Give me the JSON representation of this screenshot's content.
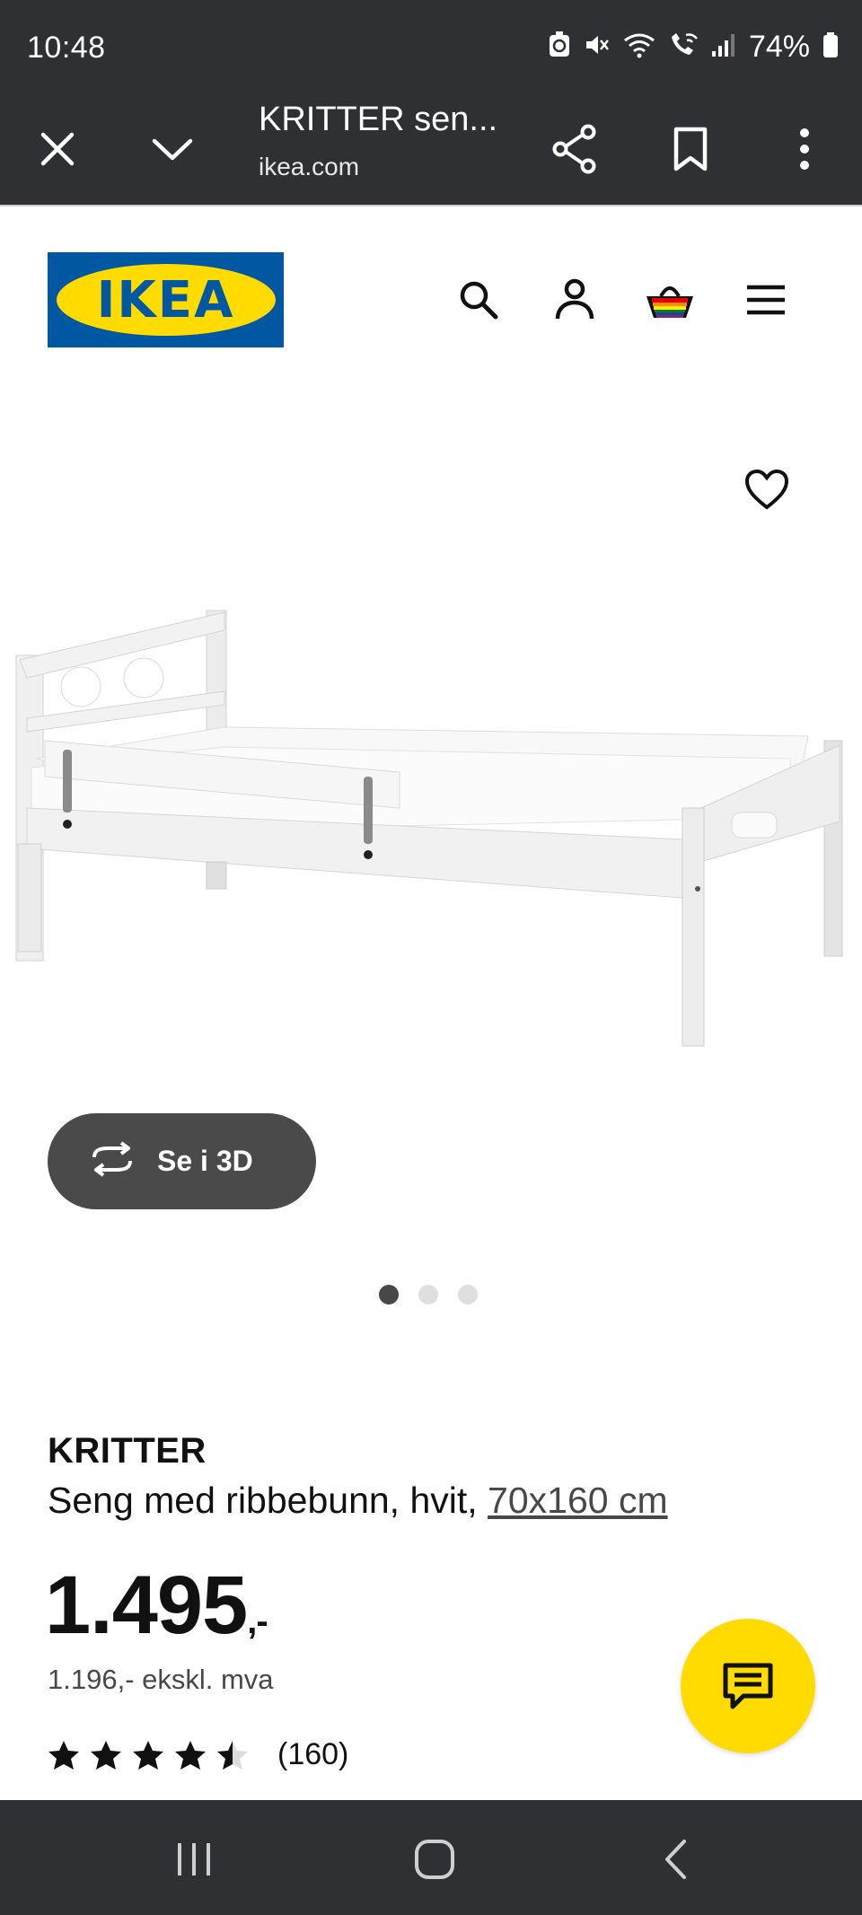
{
  "status_bar": {
    "time": "10:48",
    "battery": "74%",
    "icons": [
      "battery-saver-icon",
      "mute-icon",
      "wifi-icon",
      "wifi-calling-icon",
      "signal-icon",
      "battery-icon"
    ]
  },
  "browser": {
    "title": "KRITTER sen...",
    "url": "ikea.com",
    "icons": [
      "close-icon",
      "chevron-down-icon",
      "share-icon",
      "bookmark-icon",
      "more-icon"
    ]
  },
  "header": {
    "logo_text": "IKEA",
    "icons": [
      "search-icon",
      "account-icon",
      "basket-icon",
      "menu-icon"
    ]
  },
  "product": {
    "name": "KRITTER",
    "description": "Seng med ribbebunn, hvit, ",
    "size_link": "70x160 cm",
    "price_main": "1.495",
    "price_suffix": ",-",
    "price_ex_vat": "1.196,- ekskl. mva",
    "rating": 4.5,
    "rating_max": 5,
    "review_count": "(160)",
    "view3d_label": "Se i 3D",
    "image_count": 3,
    "active_image": 1
  },
  "colors": {
    "ikea_blue": "#0058a3",
    "ikea_yellow": "#ffdb00",
    "system_bar": "#2f3033"
  }
}
